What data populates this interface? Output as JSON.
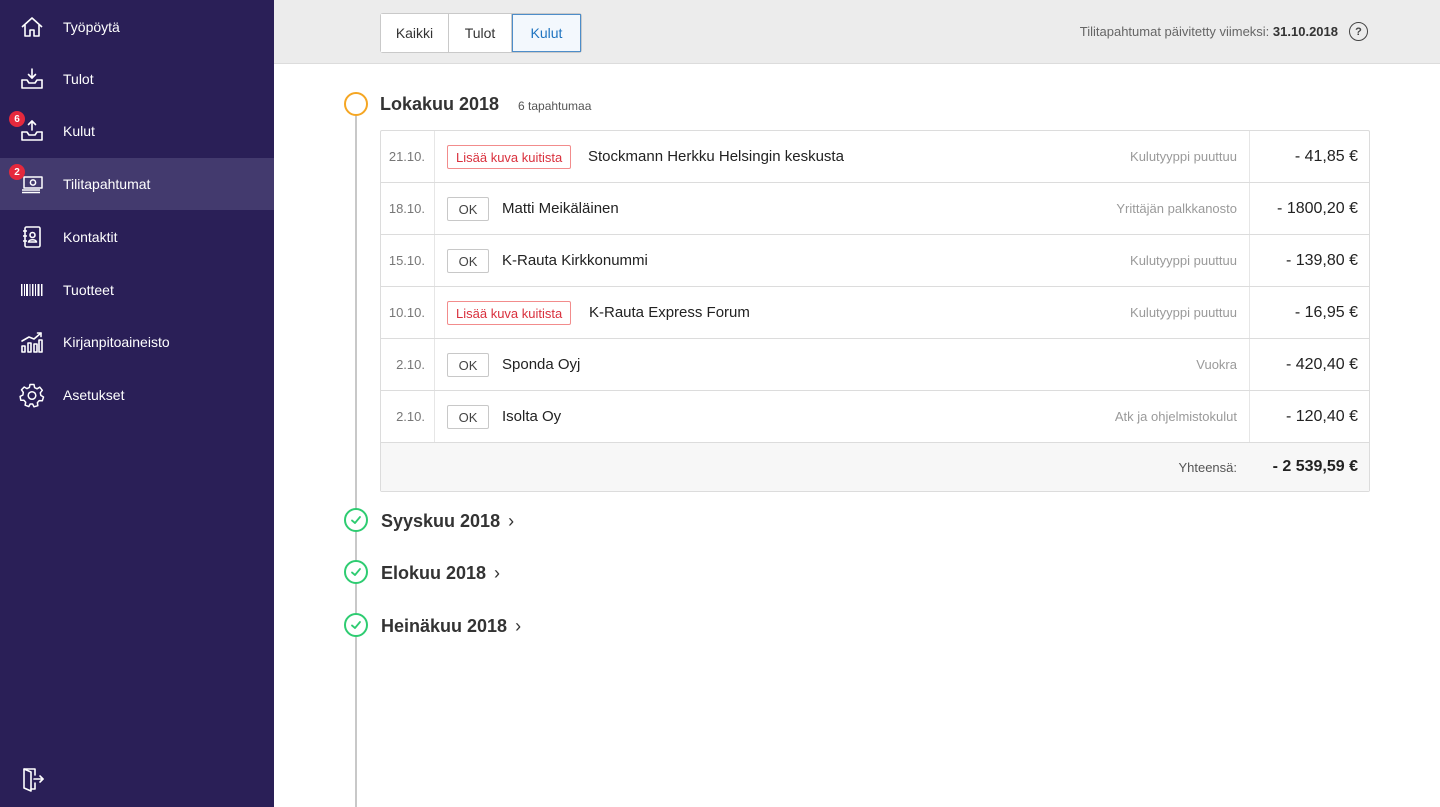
{
  "sidebar": {
    "items": [
      {
        "label": "Työpöytä",
        "icon": "home-icon"
      },
      {
        "label": "Tulot",
        "icon": "inbox-in-icon"
      },
      {
        "label": "Kulut",
        "icon": "outbox-icon",
        "badge": "6"
      },
      {
        "label": "Tilitapahtumat",
        "icon": "banknotes-icon",
        "badge": "2",
        "active": true
      },
      {
        "label": "Kontaktit",
        "icon": "contact-book-icon"
      },
      {
        "label": "Tuotteet",
        "icon": "barcode-icon"
      },
      {
        "label": "Kirjanpitoaineisto",
        "icon": "bar-chart-icon"
      },
      {
        "label": "Asetukset",
        "icon": "gear-icon"
      }
    ],
    "logout_icon": "logout-icon"
  },
  "filters": {
    "options": [
      "Kaikki",
      "Tulot",
      "Kulut"
    ],
    "selected": "Kulut"
  },
  "updated": {
    "label": "Tilitapahtumat päivitetty viimeksi:",
    "date": "31.10.2018",
    "help_icon": "?"
  },
  "months": [
    {
      "title": "Lokakuu 2018",
      "count": "6 tapahtumaa",
      "status": "open",
      "transactions": [
        {
          "date": "21.10.",
          "tag": "Lisää kuva kuitista",
          "tag_type": "warn",
          "name": "Stockmann Herkku Helsingin keskusta",
          "category": "Kulutyyppi puuttuu",
          "amount": "- 41,85 €"
        },
        {
          "date": "18.10.",
          "tag": "OK",
          "tag_type": "ok",
          "name": "Matti Meikäläinen",
          "category": "Yrittäjän palkkanosto",
          "amount": "- 1800,20 €"
        },
        {
          "date": "15.10.",
          "tag": "OK",
          "tag_type": "ok",
          "name": "K-Rauta Kirkkonummi",
          "category": "Kulutyyppi puuttuu",
          "amount": "- 139,80 €"
        },
        {
          "date": "10.10.",
          "tag": "Lisää kuva kuitista",
          "tag_type": "warn",
          "name": "K-Rauta Express Forum",
          "category": "Kulutyyppi puuttuu",
          "amount": "- 16,95 €"
        },
        {
          "date": "2.10.",
          "tag": "OK",
          "tag_type": "ok",
          "name": "Sponda Oyj",
          "category": "Vuokra",
          "amount": "- 420,40 €"
        },
        {
          "date": "2.10.",
          "tag": "OK",
          "tag_type": "ok",
          "name": "Isolta Oy",
          "category": "Atk ja ohjelmistokulut",
          "amount": "- 120,40 €"
        }
      ],
      "total_label": "Yhteensä:",
      "total": "- 2 539,59 €"
    },
    {
      "title": "Syyskuu 2018",
      "status": "done"
    },
    {
      "title": "Elokuu 2018",
      "status": "done"
    },
    {
      "title": "Heinäkuu 2018",
      "status": "done"
    }
  ],
  "colors": {
    "sidebar_bg": "#2a1f57",
    "sidebar_active": "#433a6e",
    "badge": "#e5293d",
    "open_month": "#f5a623",
    "done_month": "#2ecc71",
    "selected_filter": "#1f74c0",
    "warn_tag": "#d9303d"
  }
}
